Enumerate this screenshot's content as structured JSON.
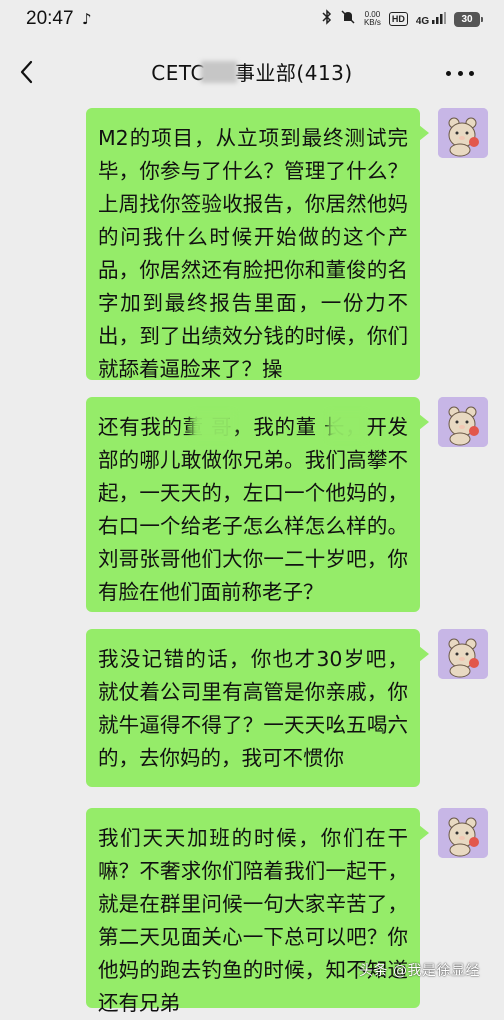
{
  "status_bar": {
    "time": "20:47",
    "net_speed_value": "0.00",
    "net_speed_unit": "KB/s",
    "hd_label": "HD",
    "network_label": "4G",
    "battery_level": "30",
    "icons": [
      "tiktok-icon",
      "bluetooth-icon",
      "mute-icon",
      "signal-icon"
    ]
  },
  "header": {
    "title_prefix": "CETC",
    "title_suffix": "事业部(413)"
  },
  "messages": [
    {
      "sender": "me",
      "text": "M2的项目，从立项到最终测试完毕，你参与了什么？管理了什么？上周找你签验收报告，你居然他妈的问我什么时候开始做的这个产品，你居然还有脸把你和董俊的名字加到最终报告里面，一份力不出，到了出绩效分钱的时候，你们就舔着逼脸来了？操"
    },
    {
      "sender": "me",
      "text": "还有我的董   哥，我的董   长，开发部的哪儿敢做你兄弟。我们高攀不起，一天天的，左口一个他妈的，右口一个给老子怎么样怎么样的。刘哥张哥他们大你一二十岁吧，你有脸在他们面前称老子？"
    },
    {
      "sender": "me",
      "text": "我没记错的话，你也才30岁吧，就仗着公司里有高管是你亲戚，你就牛逼得不得了？一天天吆五喝六的，去你妈的，我可不惯你"
    },
    {
      "sender": "me",
      "text": "我们天天加班的时候，你们在干嘛？不奢求你们陪着我们一起干，就是在群里问候一句大家辛苦了，第二天见面关心一下总可以吧？你他妈的跑去钓鱼的时候，知不知道还有兄弟"
    }
  ],
  "watermark": "头条 @我是徐显经",
  "colors": {
    "background": "#ededed",
    "bubble_green": "#95ec69",
    "avatar_bg": "#c7b6e6"
  }
}
